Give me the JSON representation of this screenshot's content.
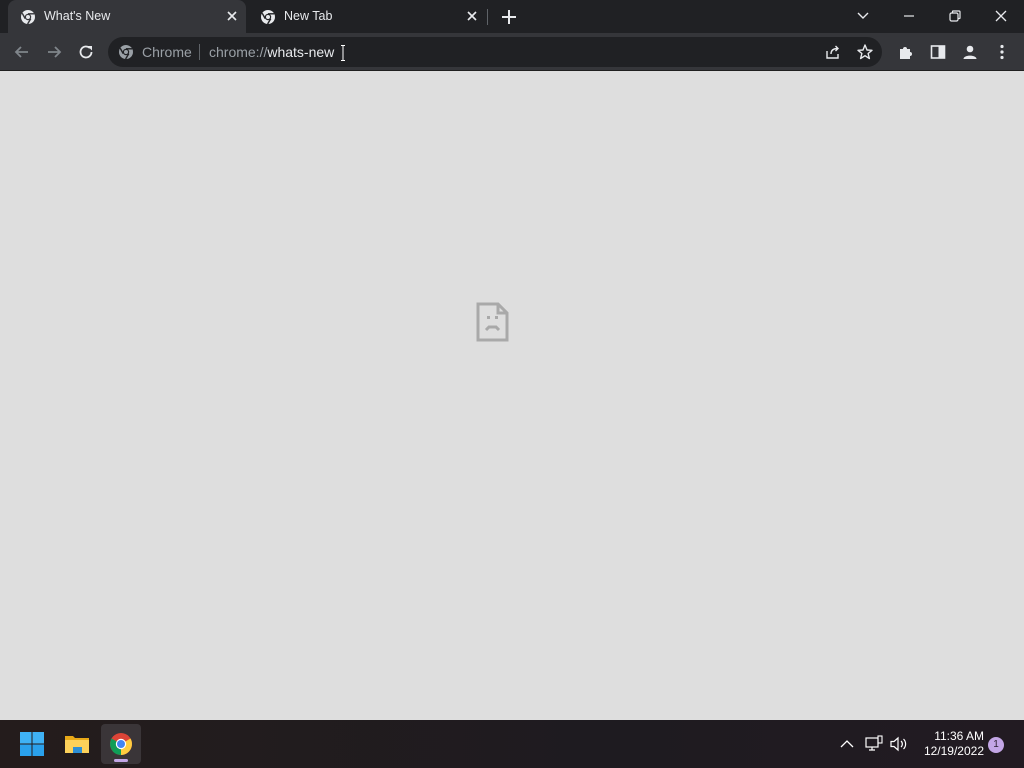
{
  "browser": {
    "tabs": [
      {
        "title": "What's New",
        "active": true
      },
      {
        "title": "New Tab",
        "active": false
      }
    ],
    "omnibox": {
      "chip": "Chrome",
      "url_scheme": "chrome://",
      "url_host": "whats-new"
    }
  },
  "page": {
    "state": "crashed",
    "icon": "sad-tab-icon",
    "background_color": "#dedede"
  },
  "taskbar": {
    "apps": [
      "start",
      "file-explorer",
      "chrome"
    ],
    "active_app": "chrome",
    "clock": {
      "time": "11:36 AM",
      "date": "12/19/2022"
    },
    "notification_count": "1"
  },
  "colors": {
    "tabstrip": "#202124",
    "toolbar": "#35363a",
    "omnibox": "#202124",
    "accent": "#c3a6e6"
  }
}
